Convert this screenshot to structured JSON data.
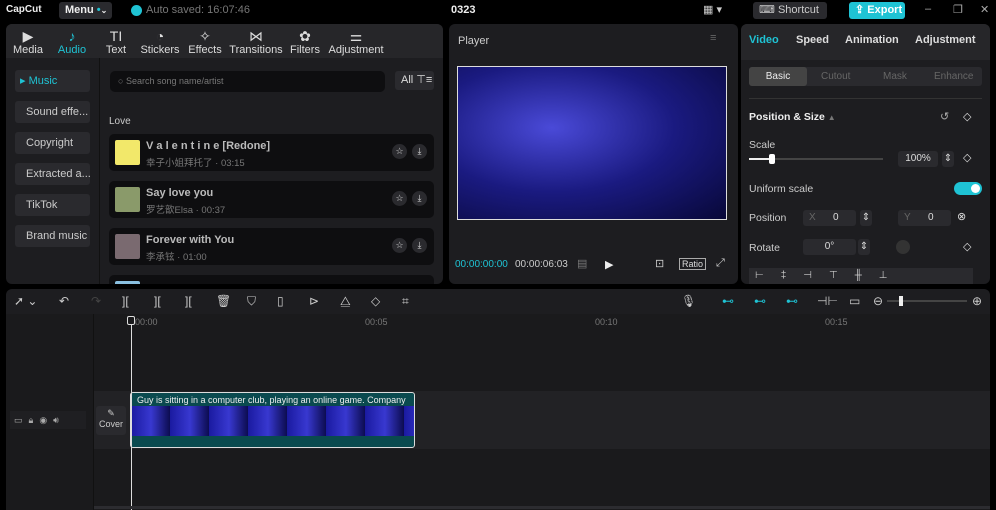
{
  "topbar": {
    "logo": "CapCut",
    "menu": "Menu",
    "autosave": "Auto saved: 16:07:46",
    "project": "0323",
    "shortcut": "Shortcut",
    "export": "Export",
    "accent": "#1fc3d4"
  },
  "tabs": [
    {
      "label": "Media",
      "icon": "media-icon"
    },
    {
      "label": "Audio",
      "icon": "audio-icon"
    },
    {
      "label": "Text",
      "icon": "text-icon"
    },
    {
      "label": "Stickers",
      "icon": "stickers-icon"
    },
    {
      "label": "Effects",
      "icon": "effects-icon"
    },
    {
      "label": "Transitions",
      "icon": "transitions-icon"
    },
    {
      "label": "Filters",
      "icon": "filters-icon"
    },
    {
      "label": "Adjustment",
      "icon": "adjustment-icon"
    }
  ],
  "sidebar": [
    "Music",
    "Sound effe...",
    "Copyright",
    "Extracted a...",
    "TikTok",
    "Brand music"
  ],
  "search": {
    "placeholder": "Search song name/artist",
    "filter": "All"
  },
  "section": "Love",
  "songs": [
    {
      "title": "V a l e n t i n e [Redone]",
      "sub": "幸子小姐拜托了 · 03:15"
    },
    {
      "title": "Say love you",
      "sub": "罗艺歆Elsa · 00:37"
    },
    {
      "title": "Forever with You",
      "sub": "李承铉 · 01:00"
    }
  ],
  "player": {
    "title": "Player",
    "current": "00:00:00:00",
    "total": "00:00:06:03",
    "ratio": "Ratio"
  },
  "right": {
    "tabs": [
      "Video",
      "Speed",
      "Animation",
      "Adjustment"
    ],
    "subtabs": [
      "Basic",
      "Cutout",
      "Mask",
      "Enhance"
    ],
    "section": "Position & Size",
    "scale_label": "Scale",
    "scale": "100%",
    "scale_fraction": 0.17,
    "uniform": "Uniform scale",
    "position": "Position",
    "x_label": "X",
    "x": "0",
    "y_label": "Y",
    "y": "0",
    "rotate": "Rotate",
    "rotate_val": "0°"
  },
  "timeline": {
    "ticks": [
      "00:00",
      "00:05",
      "00:10",
      "00:15"
    ],
    "clip": "Guy is sitting in a computer club, playing an online game. Company",
    "cover": "Cover"
  }
}
